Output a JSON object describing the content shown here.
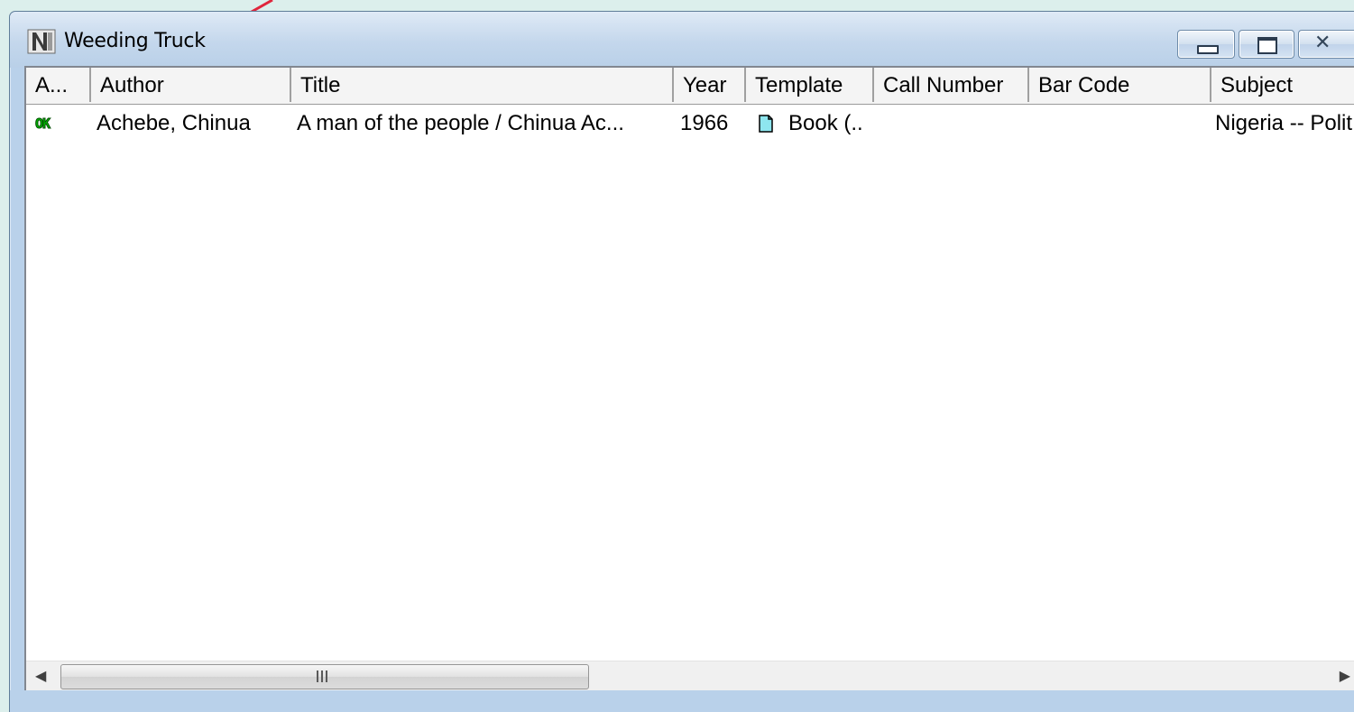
{
  "window": {
    "title": "Weeding Truck",
    "controls": {
      "minimize": "minimize",
      "maximize": "maximize",
      "close": "close"
    }
  },
  "table": {
    "columns": [
      "A...",
      "Author",
      "Title",
      "Year",
      "Template",
      "Call Number",
      "Bar Code",
      "Subject"
    ],
    "rows": [
      {
        "status": "OK",
        "author": "Achebe, Chinua",
        "title": "A man of the people / Chinua Ac...",
        "year": "1966",
        "template": "Book (..",
        "call_number": "",
        "bar_code": "",
        "subject": "Nigeria -- Polit"
      }
    ]
  },
  "scrollbar": {
    "grip": "III"
  },
  "colors": {
    "annotation_arrow": "#e0263c",
    "status_ok": "#00c000",
    "titlebar": "#c4d7ec"
  }
}
